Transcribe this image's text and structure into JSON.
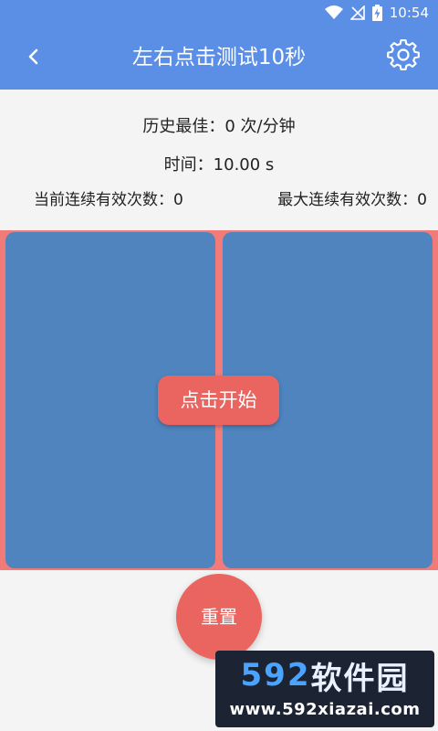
{
  "status_bar": {
    "time": "10:54",
    "icons": [
      "wifi-icon",
      "no-signal-icon",
      "battery-charging-icon"
    ]
  },
  "app_bar": {
    "title": "左右点击测试10秒",
    "back_icon": "chevron-left-icon",
    "settings_icon": "gear-icon",
    "color": "#5b8fe6"
  },
  "stats": {
    "best": "历史最佳：0 次/分钟",
    "time": "时间：10.00 s",
    "current_streak": "当前连续有效次数：0",
    "max_streak": "最大连续有效次数：0"
  },
  "tap_area": {
    "start_label": "点击开始",
    "pad_color": "#4f84bf",
    "border_color": "#f07b78"
  },
  "controls": {
    "reset_label": "重置",
    "accent": "#ea6560"
  },
  "watermark": {
    "logo_number": "592",
    "logo_text": "软件园",
    "url": "www.592xiazai.com"
  }
}
